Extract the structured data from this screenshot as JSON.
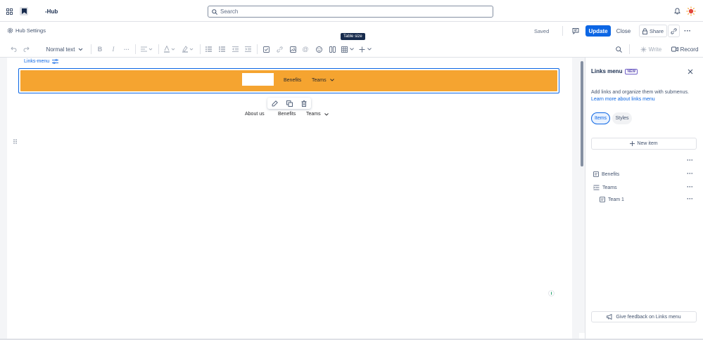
{
  "topbar": {
    "app_name": "-Hub",
    "search_placeholder": "Search"
  },
  "header": {
    "hub_settings": "Hub Settings",
    "status": "Saved",
    "update_label": "Update",
    "close_label": "Close",
    "share_label": "Share"
  },
  "toolbar": {
    "text_style": "Normal text",
    "write_label": "Write",
    "record_label": "Record",
    "tooltip": "Table size"
  },
  "canvas": {
    "links_menu_label": "Links-menu",
    "preview_items": [
      "Benefits",
      "Teams"
    ],
    "plain_items": [
      "About us",
      "Benefits",
      "Teams"
    ]
  },
  "panel": {
    "title": "Links menu",
    "badge": "NEW",
    "description": "Add links and organize them with submenus.",
    "learn_more": "Learn more about links menu",
    "tab_items": "Items",
    "tab_styles": "Styles",
    "new_item": "New item",
    "items": [
      {
        "label": "Benefits",
        "icon": "page-icon"
      },
      {
        "label": "Teams",
        "icon": "submenu-icon"
      },
      {
        "label": "Team 1",
        "icon": "page-icon"
      }
    ],
    "feedback": "Give feedback on Links menu"
  },
  "colors": {
    "accent": "#0c66e4",
    "banner": "#f5a430"
  }
}
